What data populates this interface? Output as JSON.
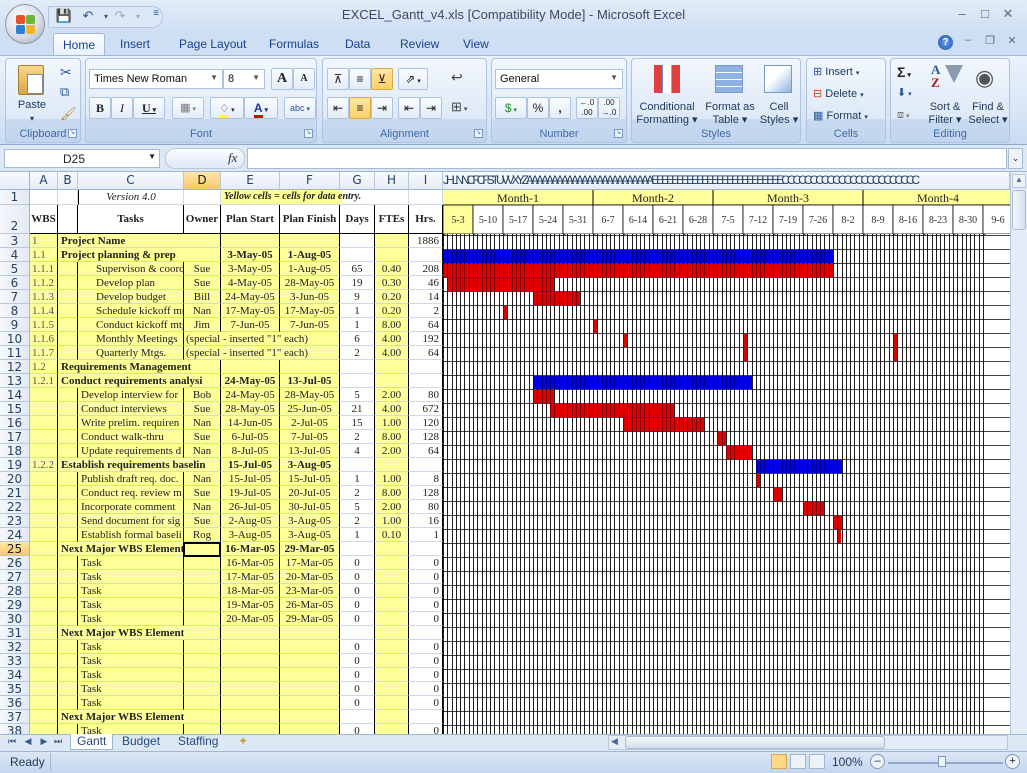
{
  "window": {
    "title": "EXCEL_Gantt_v4.xls  [Compatibility Mode] - Microsoft Excel",
    "controls": [
      "minimize",
      "maximize",
      "close"
    ]
  },
  "qat": {
    "save": "save-icon",
    "undo": "undo-icon",
    "redo": "redo-icon",
    "customize": "customize-icon"
  },
  "ribbon_tabs": [
    "Home",
    "Insert",
    "Page Layout",
    "Formulas",
    "Data",
    "Review",
    "View"
  ],
  "active_tab": "Home",
  "ribbon": {
    "clipboard": {
      "label": "Clipboard",
      "paste": "Paste"
    },
    "font": {
      "label": "Font",
      "name": "Times New Roman",
      "size": "8",
      "grow": "A",
      "shrink": "A",
      "bold": "B",
      "italic": "I",
      "underline": "U",
      "font_color": "A",
      "phonetic": "abc"
    },
    "alignment": {
      "label": "Alignment"
    },
    "number": {
      "label": "Number",
      "format": "General",
      "percent": "%",
      "comma": ",",
      "inc_decimal": ".0 .00",
      "dec_decimal": ".00 .0"
    },
    "styles": {
      "label": "Styles",
      "conditional": "Conditional Formatting",
      "format_table": "Format as Table",
      "cell_styles": "Cell Styles"
    },
    "cells": {
      "label": "Cells",
      "insert": "Insert",
      "delete": "Delete",
      "format": "Format"
    },
    "editing": {
      "label": "Editing",
      "sigma": "Σ",
      "sort": "Sort & Filter",
      "find": "Find & Select"
    }
  },
  "formula_bar": {
    "name_box": "D25",
    "fx": "fx",
    "value": ""
  },
  "columns": [
    "A",
    "B",
    "C",
    "D",
    "E",
    "F",
    "G",
    "H",
    "I"
  ],
  "gantt_col_header": "JHLNNCFCFSTUVVXYZAAAAAAAAAAAAAAAAAAAAAAAAAEEEEEEEEEEEEEEEEEEEEEEEEEECCCCCCCCCCCCCCCCCCCCCCCC",
  "selected_cell": "D25",
  "header_row1": {
    "version": "Version 4.0",
    "note": "Yellow cells = cells for data entry."
  },
  "header_row2": {
    "wbs": "WBS",
    "tasks": "Tasks",
    "owner": "Owner",
    "plan_start": "Plan Start",
    "plan_finish": "Plan Finish",
    "days": "Days",
    "ftes": "FTEs",
    "hrs": "Hrs."
  },
  "months": [
    "Month-1",
    "Month-2",
    "Month-3",
    "Month-4"
  ],
  "weeks": [
    "5-3",
    "5-10",
    "5-17",
    "5-24",
    "5-31",
    "6-7",
    "6-14",
    "6-21",
    "6-28",
    "7-5",
    "7-12",
    "7-19",
    "7-26",
    "8-2",
    "8-9",
    "8-16",
    "8-23",
    "8-30",
    "9-6"
  ],
  "rows": [
    {
      "n": "3",
      "wbs": "1",
      "task": "Project Name",
      "level": 0,
      "bold": true,
      "owner": "",
      "start": "",
      "finish": "",
      "days": "",
      "ftes": "",
      "hrs": "1886"
    },
    {
      "n": "4",
      "wbs": "1.1",
      "task": "Project planning & prep",
      "level": 0,
      "bold": true,
      "owner": "",
      "start": "3-May-05",
      "finish": "1-Aug-05",
      "days": "",
      "ftes": "",
      "hrs": ""
    },
    {
      "n": "5",
      "wbs": "1.1.1",
      "task": "Supervison & coord",
      "level": 1,
      "owner": "Sue",
      "start": "3-May-05",
      "finish": "1-Aug-05",
      "days": "65",
      "ftes": "0.40",
      "hrs": "208"
    },
    {
      "n": "6",
      "wbs": "1.1.2",
      "task": "Develop plan",
      "level": 1,
      "owner": "Sue",
      "start": "4-May-05",
      "finish": "28-May-05",
      "days": "19",
      "ftes": "0.30",
      "hrs": "46"
    },
    {
      "n": "7",
      "wbs": "1.1.3",
      "task": "Develop budget",
      "level": 1,
      "owner": "Bill",
      "start": "24-May-05",
      "finish": "3-Jun-05",
      "days": "9",
      "ftes": "0.20",
      "hrs": "14"
    },
    {
      "n": "8",
      "wbs": "1.1.4",
      "task": "Schedule kickoff mtg.",
      "level": 1,
      "owner": "Nan",
      "start": "17-May-05",
      "finish": "17-May-05",
      "days": "1",
      "ftes": "0.20",
      "hrs": "2"
    },
    {
      "n": "9",
      "wbs": "1.1.5",
      "task": "Conduct kickoff mtg.",
      "level": 1,
      "owner": "Jim",
      "start": "7-Jun-05",
      "finish": "7-Jun-05",
      "days": "1",
      "ftes": "8.00",
      "hrs": "64"
    },
    {
      "n": "10",
      "wbs": "1.1.6",
      "task": "Monthly Meetings",
      "level": 1,
      "special": "(special - inserted \"1\" each)",
      "days": "6",
      "ftes": "4.00",
      "hrs": "192"
    },
    {
      "n": "11",
      "wbs": "1.1.7",
      "task": "Quarterly Mtgs.",
      "level": 1,
      "special": "(special - inserted \"1\" each)",
      "days": "2",
      "ftes": "4.00",
      "hrs": "64"
    },
    {
      "n": "12",
      "wbs": "1.2",
      "task": "Requirements Management",
      "level": 0,
      "bold": true,
      "owner": "",
      "start": "",
      "finish": "",
      "days": "",
      "ftes": "",
      "hrs": ""
    },
    {
      "n": "13",
      "wbs": "1.2.1",
      "task": "Conduct requirements analysi",
      "level": 0,
      "bold": true,
      "owner": "",
      "start": "24-May-05",
      "finish": "13-Jul-05",
      "days": "",
      "ftes": "",
      "hrs": ""
    },
    {
      "n": "14",
      "wbs": "",
      "task": "Develop interview for",
      "level": 2,
      "owner": "Bob",
      "start": "24-May-05",
      "finish": "28-May-05",
      "days": "5",
      "ftes": "2.00",
      "hrs": "80"
    },
    {
      "n": "15",
      "wbs": "",
      "task": "Conduct interviews",
      "level": 2,
      "owner": "Sue",
      "start": "28-May-05",
      "finish": "25-Jun-05",
      "days": "21",
      "ftes": "4.00",
      "hrs": "672"
    },
    {
      "n": "16",
      "wbs": "",
      "task": "Write prelim. requiren",
      "level": 2,
      "owner": "Nan",
      "start": "14-Jun-05",
      "finish": "2-Jul-05",
      "days": "15",
      "ftes": "1.00",
      "hrs": "120"
    },
    {
      "n": "17",
      "wbs": "",
      "task": "Conduct walk-thru",
      "level": 2,
      "owner": "Sue",
      "start": "6-Jul-05",
      "finish": "7-Jul-05",
      "days": "2",
      "ftes": "8.00",
      "hrs": "128"
    },
    {
      "n": "18",
      "wbs": "",
      "task": "Update requirements d",
      "level": 2,
      "owner": "Nan",
      "start": "8-Jul-05",
      "finish": "13-Jul-05",
      "days": "4",
      "ftes": "2.00",
      "hrs": "64"
    },
    {
      "n": "19",
      "wbs": "1.2.2",
      "task": "Establish requirements baselin",
      "level": 0,
      "bold": true,
      "owner": "",
      "start": "15-Jul-05",
      "finish": "3-Aug-05",
      "days": "",
      "ftes": "",
      "hrs": ""
    },
    {
      "n": "20",
      "wbs": "",
      "task": "Publish draft req. doc.",
      "level": 2,
      "owner": "Nan",
      "start": "15-Jul-05",
      "finish": "15-Jul-05",
      "days": "1",
      "ftes": "1.00",
      "hrs": "8"
    },
    {
      "n": "21",
      "wbs": "",
      "task": "Conduct req. review m",
      "level": 2,
      "owner": "Sue",
      "start": "19-Jul-05",
      "finish": "20-Jul-05",
      "days": "2",
      "ftes": "8.00",
      "hrs": "128"
    },
    {
      "n": "22",
      "wbs": "",
      "task": "Incorporate comment",
      "level": 2,
      "owner": "Nan",
      "start": "26-Jul-05",
      "finish": "30-Jul-05",
      "days": "5",
      "ftes": "2.00",
      "hrs": "80"
    },
    {
      "n": "23",
      "wbs": "",
      "task": "Send document for sig",
      "level": 2,
      "owner": "Sue",
      "start": "2-Aug-05",
      "finish": "3-Aug-05",
      "days": "2",
      "ftes": "1.00",
      "hrs": "16"
    },
    {
      "n": "24",
      "wbs": "",
      "task": "Establish formal baseli",
      "level": 2,
      "owner": "Rog",
      "start": "3-Aug-05",
      "finish": "3-Aug-05",
      "days": "1",
      "ftes": "0.10",
      "hrs": "1"
    },
    {
      "n": "25",
      "wbs": "",
      "task": "Next Major WBS Element",
      "level": 0,
      "bold": true,
      "owner": "",
      "start": "16-Mar-05",
      "finish": "29-Mar-05",
      "days": "",
      "ftes": "",
      "hrs": ""
    },
    {
      "n": "26",
      "wbs": "",
      "task": "Task",
      "level": 2,
      "owner": "",
      "start": "16-Mar-05",
      "finish": "17-Mar-05",
      "days": "0",
      "ftes": "",
      "hrs": "0"
    },
    {
      "n": "27",
      "wbs": "",
      "task": "Task",
      "level": 2,
      "owner": "",
      "start": "17-Mar-05",
      "finish": "20-Mar-05",
      "days": "0",
      "ftes": "",
      "hrs": "0"
    },
    {
      "n": "28",
      "wbs": "",
      "task": "Task",
      "level": 2,
      "owner": "",
      "start": "18-Mar-05",
      "finish": "23-Mar-05",
      "days": "0",
      "ftes": "",
      "hrs": "0"
    },
    {
      "n": "29",
      "wbs": "",
      "task": "Task",
      "level": 2,
      "owner": "",
      "start": "19-Mar-05",
      "finish": "26-Mar-05",
      "days": "0",
      "ftes": "",
      "hrs": "0"
    },
    {
      "n": "30",
      "wbs": "",
      "task": "Task",
      "level": 2,
      "owner": "",
      "start": "20-Mar-05",
      "finish": "29-Mar-05",
      "days": "0",
      "ftes": "",
      "hrs": "0"
    },
    {
      "n": "31",
      "wbs": "",
      "task": "Next Major WBS Element",
      "level": 0,
      "bold": true,
      "owner": "",
      "start": "",
      "finish": "",
      "days": "",
      "ftes": "",
      "hrs": ""
    },
    {
      "n": "32",
      "wbs": "",
      "task": "Task",
      "level": 2,
      "owner": "",
      "start": "",
      "finish": "",
      "days": "0",
      "ftes": "",
      "hrs": "0"
    },
    {
      "n": "33",
      "wbs": "",
      "task": "Task",
      "level": 2,
      "owner": "",
      "start": "",
      "finish": "",
      "days": "0",
      "ftes": "",
      "hrs": "0"
    },
    {
      "n": "34",
      "wbs": "",
      "task": "Task",
      "level": 2,
      "owner": "",
      "start": "",
      "finish": "",
      "days": "0",
      "ftes": "",
      "hrs": "0"
    },
    {
      "n": "35",
      "wbs": "",
      "task": "Task",
      "level": 2,
      "owner": "",
      "start": "",
      "finish": "",
      "days": "0",
      "ftes": "",
      "hrs": "0"
    },
    {
      "n": "36",
      "wbs": "",
      "task": "Task",
      "level": 2,
      "owner": "",
      "start": "",
      "finish": "",
      "days": "0",
      "ftes": "",
      "hrs": "0"
    },
    {
      "n": "37",
      "wbs": "",
      "task": "Next Major WBS Element",
      "level": 0,
      "bold": true,
      "owner": "",
      "start": "",
      "finish": "",
      "days": "",
      "ftes": "",
      "hrs": ""
    },
    {
      "n": "38",
      "wbs": "",
      "task": "Task",
      "level": 2,
      "owner": "",
      "start": "",
      "finish": "",
      "days": "0",
      "ftes": "",
      "hrs": "0"
    }
  ],
  "gantt_timeline": {
    "first_day": "2005-05-03",
    "days_shown": 126
  },
  "gantt_bars": [
    {
      "row": "4",
      "kind": "summary",
      "start": "2005-05-03",
      "end": "2005-08-01"
    },
    {
      "row": "5",
      "kind": "task",
      "start": "2005-05-03",
      "end": "2005-08-01"
    },
    {
      "row": "6",
      "kind": "task",
      "start": "2005-05-04",
      "end": "2005-05-28"
    },
    {
      "row": "7",
      "kind": "task",
      "start": "2005-05-24",
      "end": "2005-06-03"
    },
    {
      "row": "8",
      "kind": "task",
      "start": "2005-05-17",
      "end": "2005-05-17"
    },
    {
      "row": "9",
      "kind": "task",
      "start": "2005-06-07",
      "end": "2005-06-07"
    },
    {
      "row": "10",
      "kind": "task",
      "start": "2005-06-14",
      "end": "2005-06-14"
    },
    {
      "row": "10",
      "kind": "task",
      "start": "2005-07-12",
      "end": "2005-07-12"
    },
    {
      "row": "11",
      "kind": "task",
      "start": "2005-07-12",
      "end": "2005-07-12"
    },
    {
      "row": "10",
      "kind": "task",
      "start": "2005-08-16",
      "end": "2005-08-16"
    },
    {
      "row": "11",
      "kind": "task",
      "start": "2005-08-16",
      "end": "2005-08-16"
    },
    {
      "row": "13",
      "kind": "summary",
      "start": "2005-05-24",
      "end": "2005-07-13"
    },
    {
      "row": "14",
      "kind": "task",
      "start": "2005-05-24",
      "end": "2005-05-28"
    },
    {
      "row": "15",
      "kind": "task",
      "start": "2005-05-28",
      "end": "2005-06-25"
    },
    {
      "row": "16",
      "kind": "task",
      "start": "2005-06-14",
      "end": "2005-07-02"
    },
    {
      "row": "17",
      "kind": "task",
      "start": "2005-07-06",
      "end": "2005-07-07"
    },
    {
      "row": "18",
      "kind": "task",
      "start": "2005-07-08",
      "end": "2005-07-13"
    },
    {
      "row": "19",
      "kind": "summary",
      "start": "2005-07-15",
      "end": "2005-08-03"
    },
    {
      "row": "20",
      "kind": "task",
      "start": "2005-07-15",
      "end": "2005-07-15"
    },
    {
      "row": "21",
      "kind": "task",
      "start": "2005-07-19",
      "end": "2005-07-20"
    },
    {
      "row": "22",
      "kind": "task",
      "start": "2005-07-26",
      "end": "2005-07-30"
    },
    {
      "row": "23",
      "kind": "task",
      "start": "2005-08-02",
      "end": "2005-08-03"
    },
    {
      "row": "24",
      "kind": "task",
      "start": "2005-08-03",
      "end": "2005-08-03"
    }
  ],
  "colors": {
    "summary": "#0000e6",
    "task": "#e00000",
    "entry_yellow": "#ffff99",
    "selected_header": "#f9c86a"
  },
  "sheet_tabs": [
    "Gantt",
    "Budget",
    "Staffing"
  ],
  "active_sheet": "Gantt",
  "status": {
    "text": "Ready",
    "zoom": "100%"
  }
}
